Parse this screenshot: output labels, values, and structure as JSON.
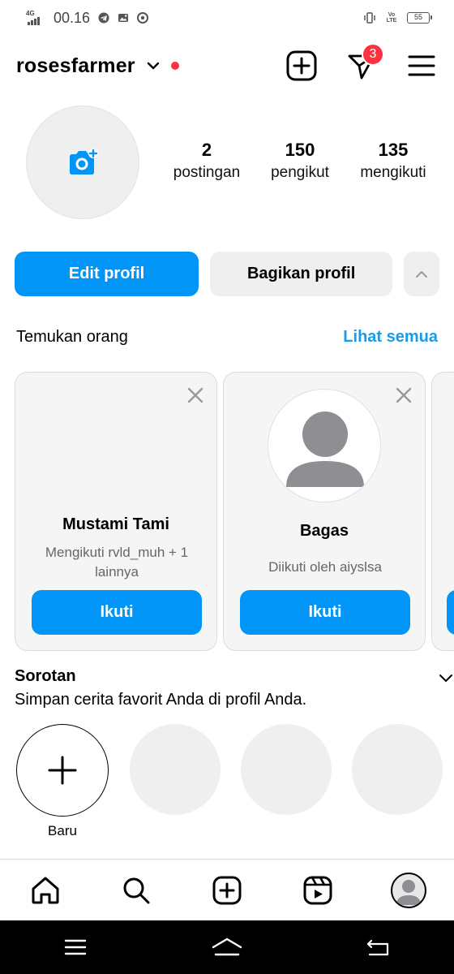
{
  "status_bar": {
    "network": "4G",
    "time": "00.16",
    "volte": "Vo LTE",
    "battery": "55"
  },
  "header": {
    "username": "rosesfarmer",
    "notification_count": "3"
  },
  "profile": {
    "stats": [
      {
        "number": "2",
        "label": "postingan"
      },
      {
        "number": "150",
        "label": "pengikut"
      },
      {
        "number": "135",
        "label": "mengikuti"
      }
    ],
    "edit_label": "Edit profil",
    "share_label": "Bagikan profil"
  },
  "discover": {
    "title": "Temukan orang",
    "see_all": "Lihat semua",
    "cards": [
      {
        "name": "Mustami Tami",
        "subtitle": "Mengikuti rvld_muh + 1 lainnya",
        "follow": "Ikuti"
      },
      {
        "name": "Bagas",
        "subtitle": "Diikuti oleh aiyslsa",
        "follow": "Ikuti"
      }
    ]
  },
  "highlights": {
    "title": "Sorotan",
    "subtitle": "Simpan cerita favorit Anda di profil Anda.",
    "new_label": "Baru"
  },
  "colors": {
    "accent": "#0095f6",
    "link": "#1a9be8",
    "badge": "#ff3040",
    "secondary_bg": "#efefef"
  },
  "icons": {
    "header": [
      "chevron-down-icon",
      "plus-square-icon",
      "direct-message-icon",
      "menu-icon"
    ],
    "tabs": [
      "home-icon",
      "search-icon",
      "create-icon",
      "reels-icon",
      "profile-avatar"
    ],
    "system": [
      "recents-icon",
      "home-nav-icon",
      "back-icon"
    ]
  }
}
